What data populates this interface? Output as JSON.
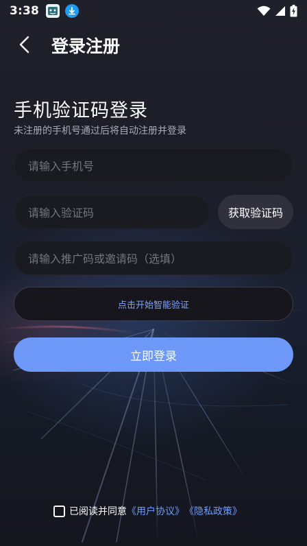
{
  "status_bar": {
    "time": "3:38",
    "icons": [
      "app-notification-icon",
      "download-icon",
      "wifi-icon",
      "cell-signal-icon",
      "battery-charging-icon"
    ]
  },
  "header": {
    "title": "登录注册",
    "back_icon": "back-arrow-icon"
  },
  "form": {
    "heading": "手机验证码登录",
    "subheading": "未注册的手机号通过后将自动注册并登录",
    "phone_placeholder": "请输入手机号",
    "code_placeholder": "请输入验证码",
    "get_code_label": "获取验证码",
    "invite_placeholder": "请输入推广码或邀请码（选填）",
    "smart_verify_label": "点击开始智能验证",
    "login_label": "立即登录"
  },
  "agreement": {
    "prefix": "已阅读并同意",
    "user_agreement": "《用户协议》",
    "privacy_policy": "《隐私政策》",
    "checked": false
  },
  "colors": {
    "accent": "#6d98f7",
    "link": "#6f9bf8",
    "background": "#1b1c26"
  }
}
